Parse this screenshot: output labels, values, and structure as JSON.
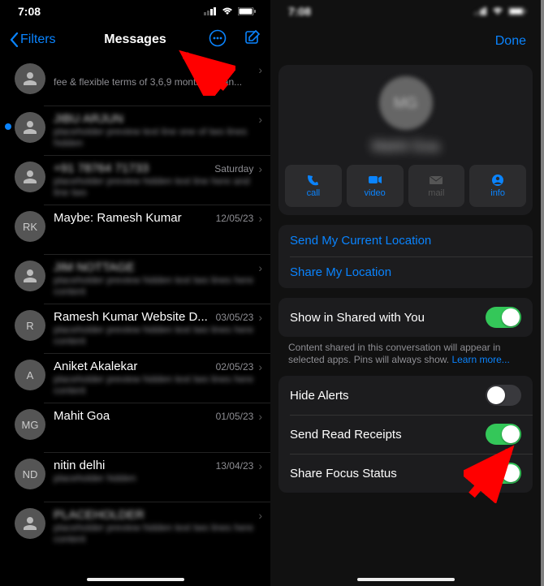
{
  "status": {
    "time": "7:08"
  },
  "left": {
    "filters": "Filters",
    "title": "Messages",
    "rows": [
      {
        "unread": false,
        "avatar": "",
        "name": "",
        "name_blur": true,
        "date": "",
        "preview": "fee & flexible terms of 3,6,9 months. Scan...",
        "preview_blur": false
      },
      {
        "unread": true,
        "avatar": "",
        "name": "JIBU ARJUN",
        "name_blur": true,
        "date": "",
        "preview": "placeholder preview text line one of two lines hidden",
        "preview_blur": true
      },
      {
        "unread": false,
        "avatar": "",
        "name": "+91 78764 71733",
        "name_blur": true,
        "date": "Saturday",
        "preview": "placeholder preview hidden text line here and line two",
        "preview_blur": true
      },
      {
        "unread": false,
        "avatar": "RK",
        "name": "Maybe: Ramesh Kumar",
        "name_blur": false,
        "date": "12/05/23",
        "preview": "",
        "preview_blur": true
      },
      {
        "unread": false,
        "avatar": "",
        "name": "JIM NOTTAGE",
        "name_blur": true,
        "date": "",
        "preview": "placeholder preview hidden text two lines here content",
        "preview_blur": true
      },
      {
        "unread": false,
        "avatar": "R",
        "name": "Ramesh Kumar Website D...",
        "name_blur": false,
        "date": "03/05/23",
        "preview": "placeholder preview hidden text two lines here content",
        "preview_blur": true
      },
      {
        "unread": false,
        "avatar": "A",
        "name": "Aniket Akalekar",
        "name_blur": false,
        "date": "02/05/23",
        "preview": "placeholder preview hidden text two lines here content",
        "preview_blur": true
      },
      {
        "unread": false,
        "avatar": "MG",
        "name": "Mahit Goa",
        "name_blur": false,
        "date": "01/05/23",
        "preview": "",
        "preview_blur": true
      },
      {
        "unread": false,
        "avatar": "ND",
        "name": "nitin delhi",
        "name_blur": false,
        "date": "13/04/23",
        "preview": "placeholder hidden",
        "preview_blur": true
      },
      {
        "unread": false,
        "avatar": "",
        "name": "PLACEHOLDER",
        "name_blur": true,
        "date": "",
        "preview": "placeholder preview hidden text two lines here content",
        "preview_blur": true
      }
    ]
  },
  "right": {
    "done": "Done",
    "profile": {
      "avatar": "MG",
      "name": "Mahit Goa"
    },
    "actions": {
      "call": {
        "label": "call",
        "enabled": true
      },
      "video": {
        "label": "video",
        "enabled": true
      },
      "mail": {
        "label": "mail",
        "enabled": false
      },
      "info": {
        "label": "info",
        "enabled": true
      }
    },
    "location": {
      "send_current": "Send My Current Location",
      "share": "Share My Location"
    },
    "shared": {
      "label": "Show in Shared with You",
      "on": true,
      "footnote_text": "Content shared in this conversation will appear in selected apps. Pins will always show. ",
      "footnote_link": "Learn more..."
    },
    "settings": {
      "hide_alerts": {
        "label": "Hide Alerts",
        "on": false
      },
      "read_receipts": {
        "label": "Send Read Receipts",
        "on": true
      },
      "focus_status": {
        "label": "Share Focus Status",
        "on": true
      }
    }
  }
}
